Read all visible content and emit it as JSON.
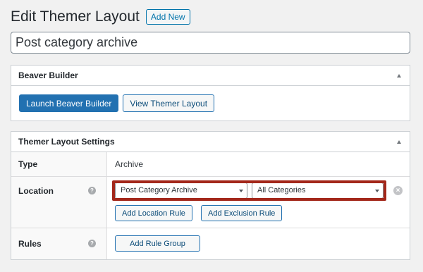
{
  "page": {
    "title": "Edit Themer Layout",
    "add_new_label": "Add New"
  },
  "title_input": {
    "value": "Post category archive"
  },
  "beaver_builder_box": {
    "title": "Beaver Builder",
    "launch_button": "Launch Beaver Builder",
    "view_button": "View Themer Layout"
  },
  "settings_box": {
    "title": "Themer Layout Settings",
    "type_row": {
      "label": "Type",
      "value": "Archive"
    },
    "location_row": {
      "label": "Location",
      "location_select": "Post Category Archive",
      "category_select": "All Categories",
      "add_location_rule": "Add Location Rule",
      "add_exclusion_rule": "Add Exclusion Rule"
    },
    "rules_row": {
      "label": "Rules",
      "add_rule_group": "Add Rule Group"
    },
    "help_glyph": "?",
    "remove_glyph": "×"
  },
  "colors": {
    "highlight": "#a3271a",
    "primary_button": "#2271b1",
    "link": "#0073aa"
  }
}
